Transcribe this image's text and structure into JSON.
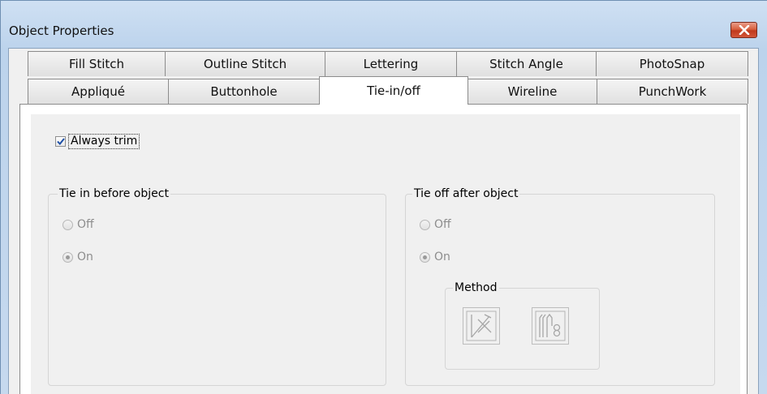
{
  "window": {
    "title": "Object Properties"
  },
  "tabs_row1": [
    "Fill Stitch",
    "Outline Stitch",
    "Lettering",
    "Stitch Angle",
    "PhotoSnap"
  ],
  "tabs_row2": [
    "Appliqué",
    "Buttonhole",
    "Tie-in/off",
    "Wireline",
    "PunchWork"
  ],
  "active_tab": "Tie-in/off",
  "always_trim": {
    "label": "Always trim",
    "checked": true
  },
  "tie_in": {
    "legend": "Tie in before object",
    "options": [
      "Off",
      "On"
    ],
    "selected": "On",
    "enabled": false
  },
  "tie_off": {
    "legend": "Tie off after object",
    "options": [
      "Off",
      "On"
    ],
    "selected": "On",
    "enabled": false,
    "method": {
      "legend": "Method",
      "buttons": [
        "tie-off-cross-icon",
        "tie-off-loop-icon"
      ]
    }
  },
  "colors": {
    "close_red": "#c7412a",
    "active_tab": "#ffffff",
    "disabled_text": "#8d8d8d"
  }
}
